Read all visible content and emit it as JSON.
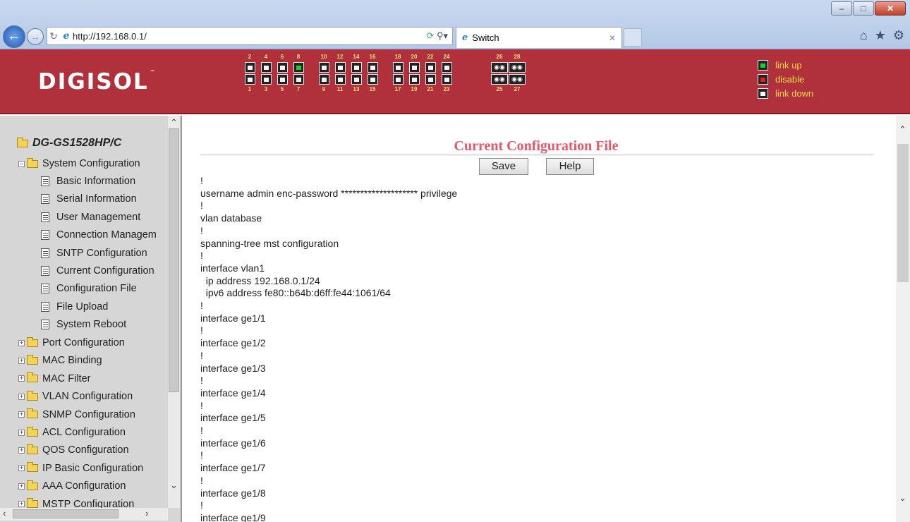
{
  "browser": {
    "url": "http://192.168.0.1/",
    "tab_title": "Switch",
    "window_controls": [
      "minimize",
      "maximize",
      "close"
    ],
    "toolbar_icons": [
      "home-icon",
      "favorites-star-icon",
      "settings-gear-icon"
    ]
  },
  "banner": {
    "logo": "DIGISOL",
    "trademark": "™",
    "ports_top": [
      "2",
      "4",
      "6",
      "8",
      "10",
      "12",
      "14",
      "16",
      "18",
      "20",
      "22",
      "24",
      "26",
      "28"
    ],
    "ports_bottom": [
      "1",
      "3",
      "5",
      "7",
      "9",
      "11",
      "13",
      "15",
      "17",
      "19",
      "21",
      "23",
      "25",
      "27"
    ],
    "ports_up": [
      "8"
    ],
    "legend": [
      {
        "label": "link up",
        "state": "up",
        "color": "#1dd12a"
      },
      {
        "label": "disable",
        "state": "disable",
        "color": "#e02020"
      },
      {
        "label": "link down",
        "state": "down",
        "color": "#ffffff"
      }
    ]
  },
  "sidebar": {
    "root": "DG-GS1528HP/C",
    "expanded_group": "System Configuration",
    "system_items": [
      "Basic Information",
      "Serial Information",
      "User Management",
      "Connection Managem",
      "SNTP Configuration",
      "Current Configuration",
      "Configuration File",
      "File Upload",
      "System Reboot"
    ],
    "groups": [
      "Port Configuration",
      "MAC Binding",
      "MAC Filter",
      "VLAN Configuration",
      "SNMP Configuration",
      "ACL Configuration",
      "QOS Configuration",
      "IP Basic Configuration",
      "AAA Configuration",
      "MSTP Configuration"
    ]
  },
  "main": {
    "title": "Current Configuration File",
    "save_label": "Save",
    "help_label": "Help",
    "config_lines": [
      "!",
      "username admin enc-password ******************** privilege",
      "!",
      "vlan database",
      "!",
      "spanning-tree mst configuration",
      "!",
      "interface vlan1",
      "  ip address 192.168.0.1/24",
      "  ipv6 address fe80::b64b:d6ff:fe44:1061/64",
      "!",
      "interface ge1/1",
      "!",
      "interface ge1/2",
      "!",
      "interface ge1/3",
      "!",
      "interface ge1/4",
      "!",
      "interface ge1/5",
      "!",
      "interface ge1/6",
      "!",
      "interface ge1/7",
      "!",
      "interface ge1/8",
      "!",
      "interface ge1/9"
    ]
  }
}
